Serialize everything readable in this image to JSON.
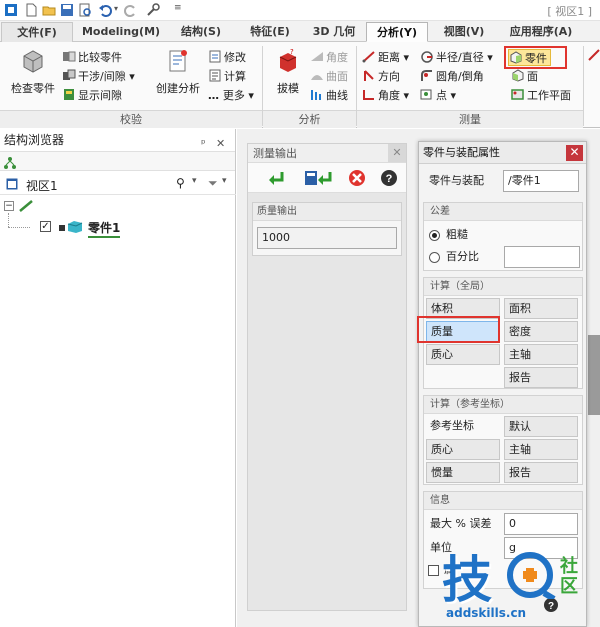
{
  "window": {
    "title": "[ 视区1 ]"
  },
  "tabs": [
    {
      "label": "文件(F)"
    },
    {
      "label": "Modeling(M)"
    },
    {
      "label": "结构(S)"
    },
    {
      "label": "特征(E)"
    },
    {
      "label": "3D 几何"
    },
    {
      "label": "分析(Y)"
    },
    {
      "label": "视图(V)"
    },
    {
      "label": "应用程序(A)"
    }
  ],
  "ribbon": {
    "check": {
      "label": "校验",
      "inspect": "检查零件",
      "compare": "比较零件",
      "interference": "干涉/间隙",
      "show_gap": "显示间隙",
      "create_analysis": "创建分析",
      "modify": "修改",
      "calc": "计算",
      "more": "更多"
    },
    "analysis": {
      "label": "分析",
      "draft": "拔模",
      "angle": "角度",
      "surface": "曲面",
      "curve": "曲线"
    },
    "measure": {
      "label": "测量",
      "distance": "距离",
      "radius": "半径/直径",
      "part": "零件",
      "direction": "方向",
      "round_chamfer": "圆角/倒角",
      "face": "面",
      "angle": "角度",
      "point": "点",
      "workplane": "工作平面"
    }
  },
  "browser": {
    "title": "结构浏览器",
    "viewport": "视区1",
    "part": "零件1"
  },
  "measure_output": {
    "title": "测量输出",
    "section": "质量输出",
    "value": "1000"
  },
  "props": {
    "title": "零件与装配属性",
    "target_label": "零件与装配",
    "target_value": "/零件1",
    "tolerance": {
      "title": "公差",
      "coarse": "粗糙",
      "percent": "百分比",
      "percent_value": ""
    },
    "calc_global": {
      "title": "计算（全局）",
      "volume": "体积",
      "area": "面积",
      "mass": "质量",
      "density": "密度",
      "centroid": "质心",
      "principal_axis": "主轴",
      "report": "报告"
    },
    "calc_ref": {
      "title": "计算（参考坐标）",
      "ref_coord": "参考坐标",
      "default": "默认",
      "centroid": "质心",
      "principal_axis": "主轴",
      "inertia": "惯量",
      "report": "报告"
    },
    "info": {
      "title": "信息",
      "max_error_label": "最大 % 误差",
      "max_error_value": "0",
      "unit_label": "单位",
      "unit_value": "g",
      "checkbox_label": "属"
    }
  },
  "watermark": {
    "main": "技",
    "side1": "社",
    "side2": "区",
    "url": "addskills.cn"
  },
  "colors": {
    "accent_red": "#e0342e",
    "active_tab_border": "#b6b6b6",
    "selected_btn": "#cfe5fb",
    "close_red": "#c5363c",
    "watermark_blue": "#1f72c6",
    "watermark_orange": "#f08a1c"
  }
}
